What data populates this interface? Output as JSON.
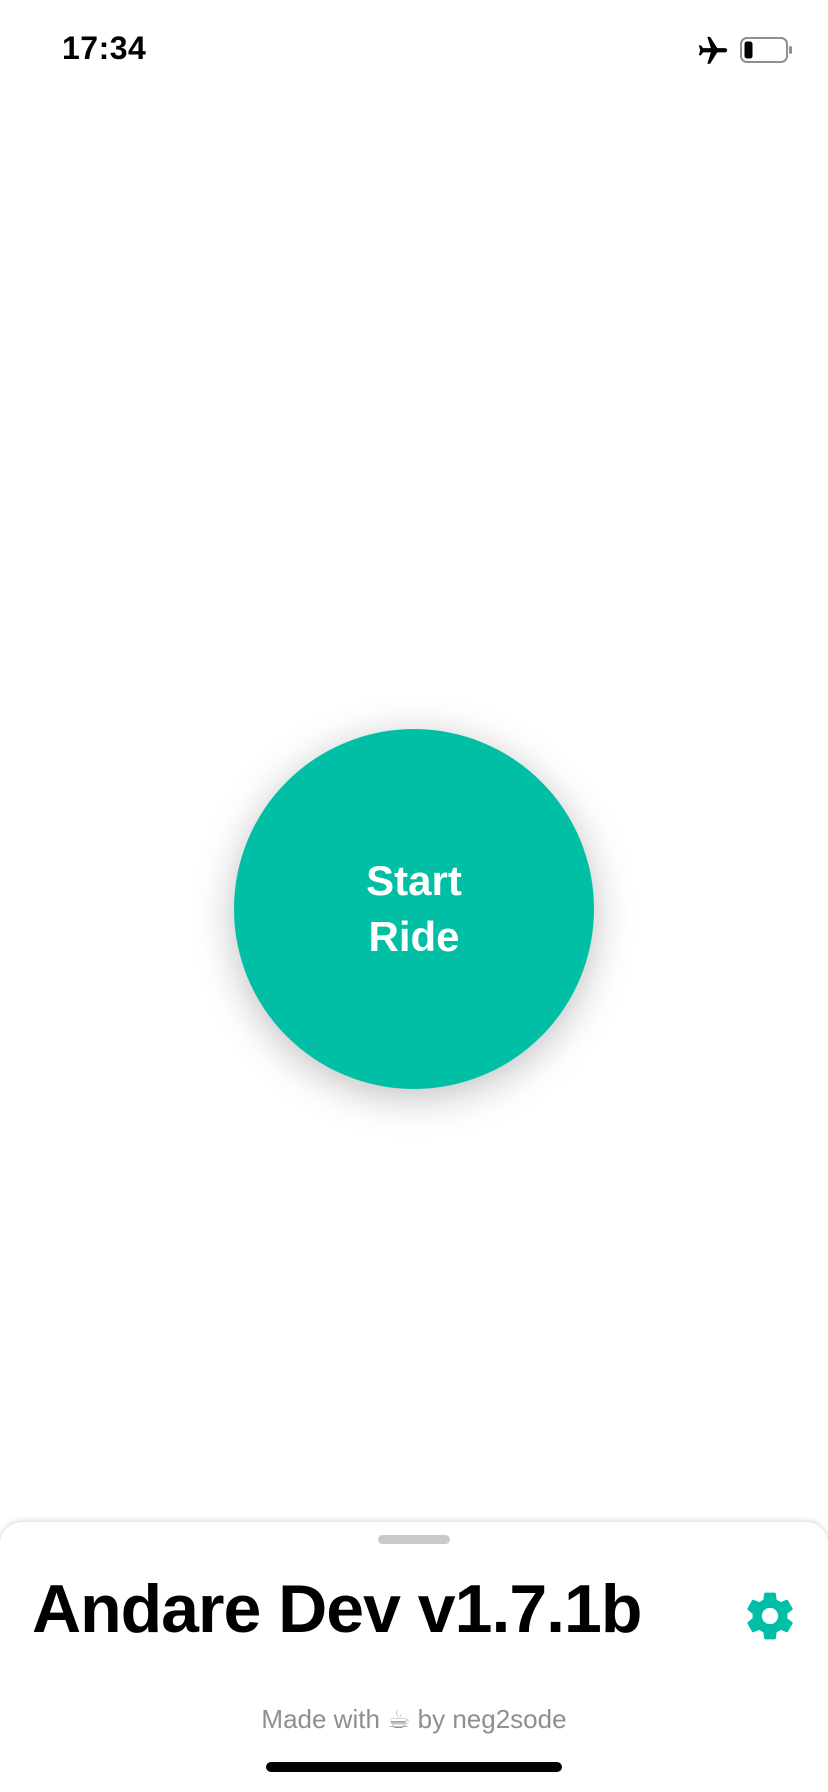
{
  "status_bar": {
    "time": "17:34",
    "icons": [
      "airplane-icon",
      "battery-icon"
    ]
  },
  "main": {
    "start_ride_label": "Start\nRide",
    "accent_color": "#00BFA5"
  },
  "bottom_sheet": {
    "title": "Andare Dev v1.7.1b",
    "settings_icon": "gear-icon",
    "credit": "Made with ☕ by neg2sode"
  }
}
